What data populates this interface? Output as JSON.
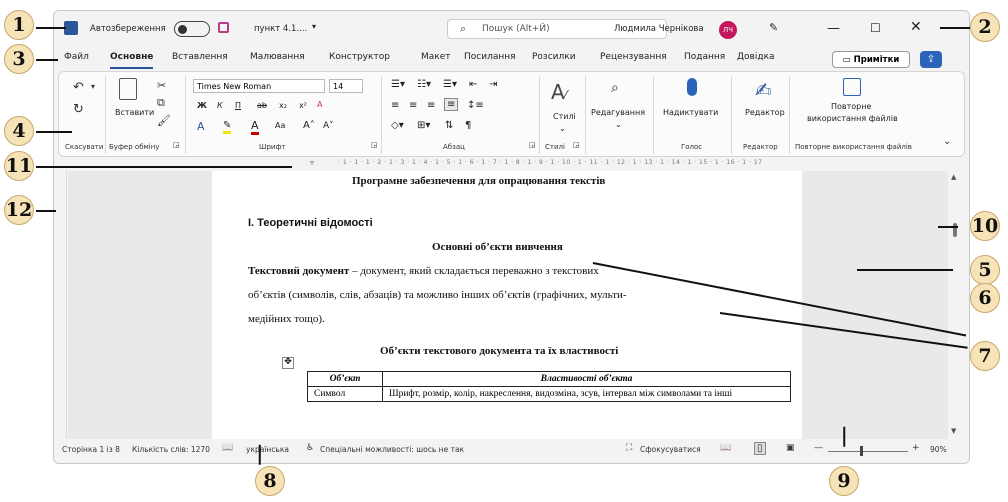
{
  "window": {
    "autosave_label": "Автозбереження",
    "doc_name": "пункт 4.1....",
    "search_placeholder": "Пошук (Alt+Й)",
    "user_name": "Людмила Чернікова",
    "user_initials": "ЛЧ"
  },
  "menu": {
    "tabs": [
      "Файл",
      "Основне",
      "Вставлення",
      "Малювання",
      "Конструктор",
      "Макет",
      "Посилання",
      "Розсилки",
      "Рецензування",
      "Подання",
      "Довідка"
    ],
    "active_tab": "Основне",
    "notes_button": "Примітки"
  },
  "ribbon": {
    "undo_group": "Скасувати",
    "clipboard_group": "Буфер обміну",
    "paste_label": "Вставити",
    "font_group": "Шрифт",
    "font_name": "Times New Roman",
    "font_size": "14",
    "bold": "Ж",
    "italic": "К",
    "underline": "П",
    "paragraph_group": "Абзац",
    "styles_label": "Стилі",
    "styles_group": "Стилі",
    "editing_label": "Редагування",
    "dictate_label": "Надиктувати",
    "voice_group": "Голос",
    "editor_label": "Редактор",
    "editor_group": "Редактор",
    "reuse_label_1": "Повторне",
    "reuse_label_2": "використання файлів",
    "reuse_group": "Повторне використання файлів"
  },
  "ruler": {
    "ticks": "· 1 · 1 · 1 · 2 · 1 · 3 · 1 · 4 · 1 · 5 · 1 · 6 · 1 · 7 · 1 · 8 · 1 · 9 · 1 · 10 · 1 · 11 · 1 · 12 · 1 · 13 · 1 · 14 · 1 · 15 · 1 · 16 · 1 · 17"
  },
  "document": {
    "heading": "Програмне забезпечення для опрацювання текстів",
    "section": "І. Теоретичні відомості",
    "subheading": "Основні об’єкти вивчення",
    "para_term": "Текстовий документ",
    "para_line1": " – документ, який складається переважно з текстових",
    "para_line2": "об’єктів (символів, слів, абзаців) та можливо інших об’єктів (графічних, мульти-",
    "para_line3": "медійних тощо).",
    "table_title": "Об’єкти текстового документа та їх властивості",
    "table_headers": [
      "Об’єкт",
      "Властивості об’єкта"
    ],
    "table_rows": [
      [
        "Символ",
        "Шрифт, розмір, колір, накреслення, видозміна, зсув, інтервал між символами та інші"
      ]
    ]
  },
  "status": {
    "page": "Сторінка 1 із 8",
    "words": "Кількість слів: 1270",
    "language": "українська",
    "accessibility": "Спеціальні можливості: шось не так",
    "focus": "Сфокусуватися",
    "zoom": "90%"
  },
  "callouts": [
    "1",
    "2",
    "3",
    "4",
    "5",
    "6",
    "7",
    "8",
    "9",
    "10",
    "11",
    "12"
  ]
}
